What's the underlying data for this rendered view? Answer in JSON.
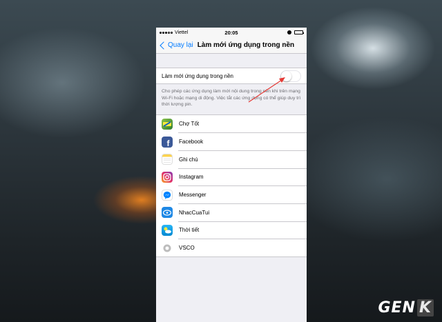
{
  "status_bar": {
    "carrier": "Viettel",
    "time": "20:05"
  },
  "nav": {
    "back_label": "Quay lại",
    "title": "Làm mới ứng dụng trong nền"
  },
  "toggle_row": {
    "label": "Làm mới ứng dụng trong nền",
    "state": "off"
  },
  "footnote": "Cho phép các ứng dụng làm mới nội dung trong nền khi trên mạng Wi-Fi hoặc mạng di động. Việc tắt các ứng dụng có thể giúp duy trì thời lượng pin.",
  "apps": [
    {
      "name": "Chợ Tốt",
      "icon": "cho-tot-icon",
      "color": "#4caf50"
    },
    {
      "name": "Facebook",
      "icon": "facebook-icon",
      "color": "#3b5998"
    },
    {
      "name": "Ghi chú",
      "icon": "notes-icon",
      "color": "#fcd34d"
    },
    {
      "name": "Instagram",
      "icon": "instagram-icon",
      "color": "#c13584"
    },
    {
      "name": "Messenger",
      "icon": "messenger-icon",
      "color": "#0084ff"
    },
    {
      "name": "NhacCuaTui",
      "icon": "nhaccuatui-icon",
      "color": "#1e88e5"
    },
    {
      "name": "Thời tiết",
      "icon": "weather-icon",
      "color": "#4fc3f7"
    },
    {
      "name": "VSCO",
      "icon": "vsco-icon",
      "color": "#9e9e9e"
    }
  ],
  "watermark": {
    "text": "GEN",
    "accent": "K"
  },
  "colors": {
    "ios_blue": "#007aff",
    "annotation_red": "#e53935"
  }
}
